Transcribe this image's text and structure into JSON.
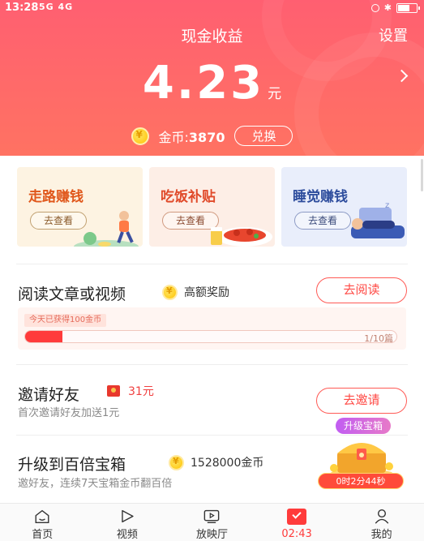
{
  "status_bar": {
    "time": "13:28",
    "network": "5G 4G"
  },
  "header": {
    "title": "现金收益",
    "settings_label": "设置",
    "amount": "4.23",
    "amount_unit": "元",
    "coin_label": "金币:",
    "coin_count": "3870",
    "exchange_label": "兑换"
  },
  "cards": [
    {
      "title": "走路赚钱",
      "button": "去查看"
    },
    {
      "title": "吃饭补贴",
      "button": "去查看"
    },
    {
      "title": "睡觉赚钱",
      "button": "去查看"
    }
  ],
  "tasks": {
    "read": {
      "title": "阅读文章或视频",
      "extra": "高额奖励",
      "button": "去阅读",
      "today_tag": "今天已获得100金币",
      "progress_text": "1/10篇",
      "progress_value": 0.1
    },
    "invite": {
      "title": "邀请好友",
      "extra": "31元",
      "subtitle": "首次邀请好友加送1元",
      "button": "去邀请"
    },
    "upgrade": {
      "title": "升级到百倍宝箱",
      "extra": "1528000金币",
      "subtitle": "邀好友，连续7天宝箱金币翻百倍"
    }
  },
  "treasure": {
    "tag": "升级宝箱",
    "timer": "0时2分44秒"
  },
  "bottom_nav": [
    {
      "label": "首页",
      "icon": "home-icon"
    },
    {
      "label": "视频",
      "icon": "play-icon"
    },
    {
      "label": "放映厅",
      "icon": "screen-icon"
    },
    {
      "label": "02:43",
      "icon": "timer-check-icon",
      "active": true
    },
    {
      "label": "我的",
      "icon": "person-icon"
    }
  ],
  "colors": {
    "header_gradient_start": "#ff5f71",
    "header_gradient_end": "#ff7262",
    "accent_red": "#ff3b3b",
    "walk_title": "#e0571b",
    "eat_title": "#e04a2a",
    "sleep_title": "#2f4e9e"
  }
}
